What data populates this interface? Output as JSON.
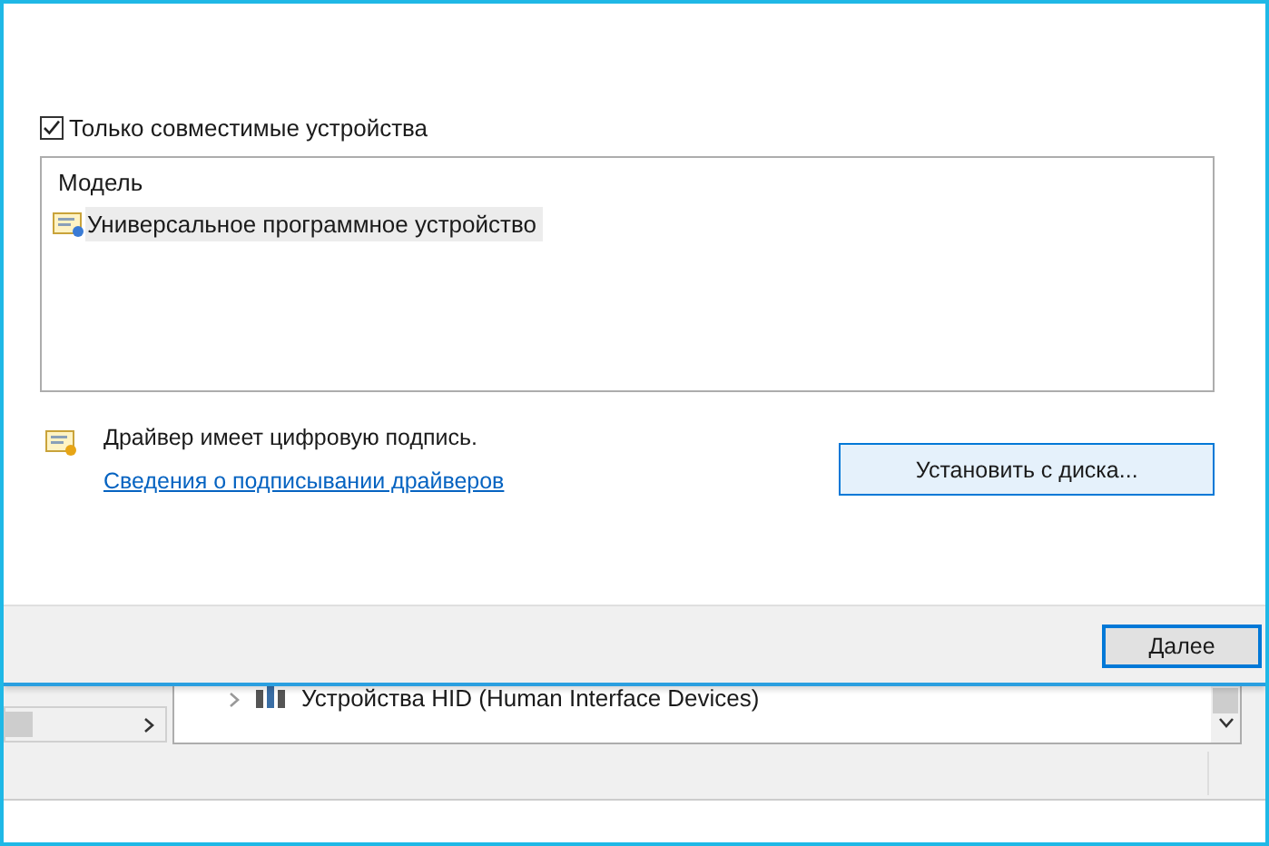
{
  "dialog": {
    "compatible_only": {
      "label": "Только совместимые устройства",
      "checked": true
    },
    "model_list": {
      "header": "Модель",
      "items": [
        {
          "label": "Универсальное программное устройство",
          "selected": true
        }
      ]
    },
    "signature": {
      "text": "Драйвер имеет цифровую подпись.",
      "link": "Сведения о подписывании драйверов"
    },
    "install_button": "Установить с диска...",
    "next_button": "Далее"
  },
  "background_window": {
    "tree_item": "Устройства HID (Human Interface Devices)"
  }
}
